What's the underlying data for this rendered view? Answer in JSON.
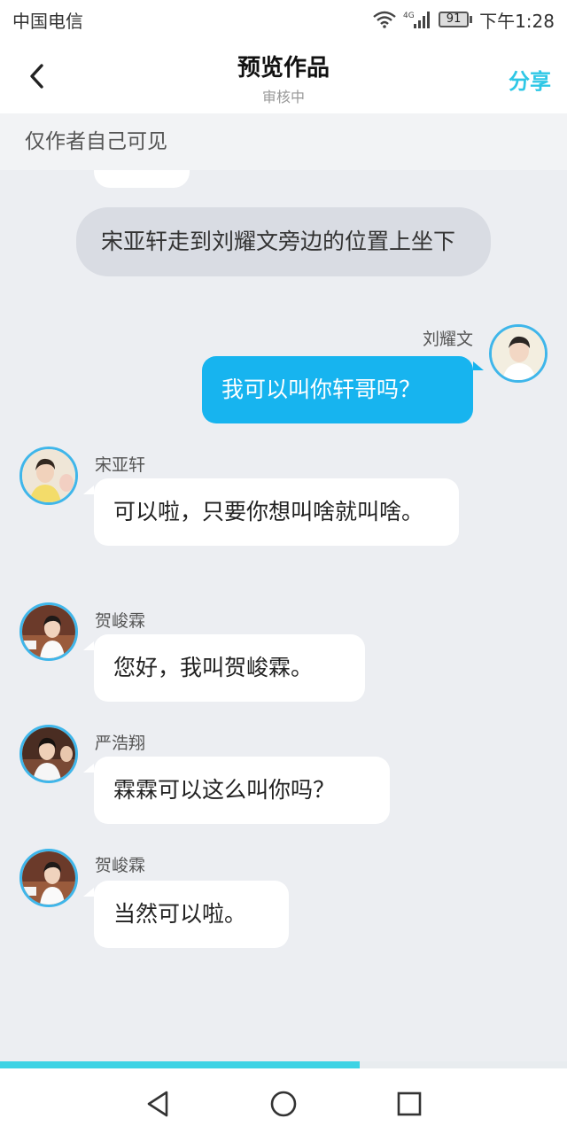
{
  "status_bar": {
    "carrier": "中国电信",
    "network": "4G",
    "battery": "91",
    "time": "下午1:28"
  },
  "header": {
    "back_icon": "chevron-left-icon",
    "title": "预览作品",
    "subtitle": "审核中",
    "share_label": "分享"
  },
  "notice": "仅作者自己可见",
  "chat": {
    "narration": "宋亚轩走到刘耀文旁边的位置上坐下",
    "messages": [
      {
        "sender": "刘耀文",
        "side": "right",
        "text": "我可以叫你轩哥吗？"
      },
      {
        "sender": "宋亚轩",
        "side": "left",
        "text": "可以啦，只要你想叫啥就叫啥。"
      },
      {
        "sender": "贺峻霖",
        "side": "left",
        "text": "您好，我叫贺峻霖。"
      },
      {
        "sender": "严浩翔",
        "side": "left",
        "text": "霖霖可以这么叫你吗？"
      },
      {
        "sender": "贺峻霖",
        "side": "left",
        "text": "当然可以啦。"
      }
    ]
  },
  "progress": {
    "fraction": 0.635,
    "color": "#3dd3e4"
  },
  "nav_bar": {
    "back_icon": "triangle-back-icon",
    "home_icon": "circle-home-icon",
    "recents_icon": "square-recents-icon"
  },
  "colors": {
    "accent": "#2ec7e6",
    "self_bubble": "#17b4ef",
    "background": "#eceef2"
  }
}
